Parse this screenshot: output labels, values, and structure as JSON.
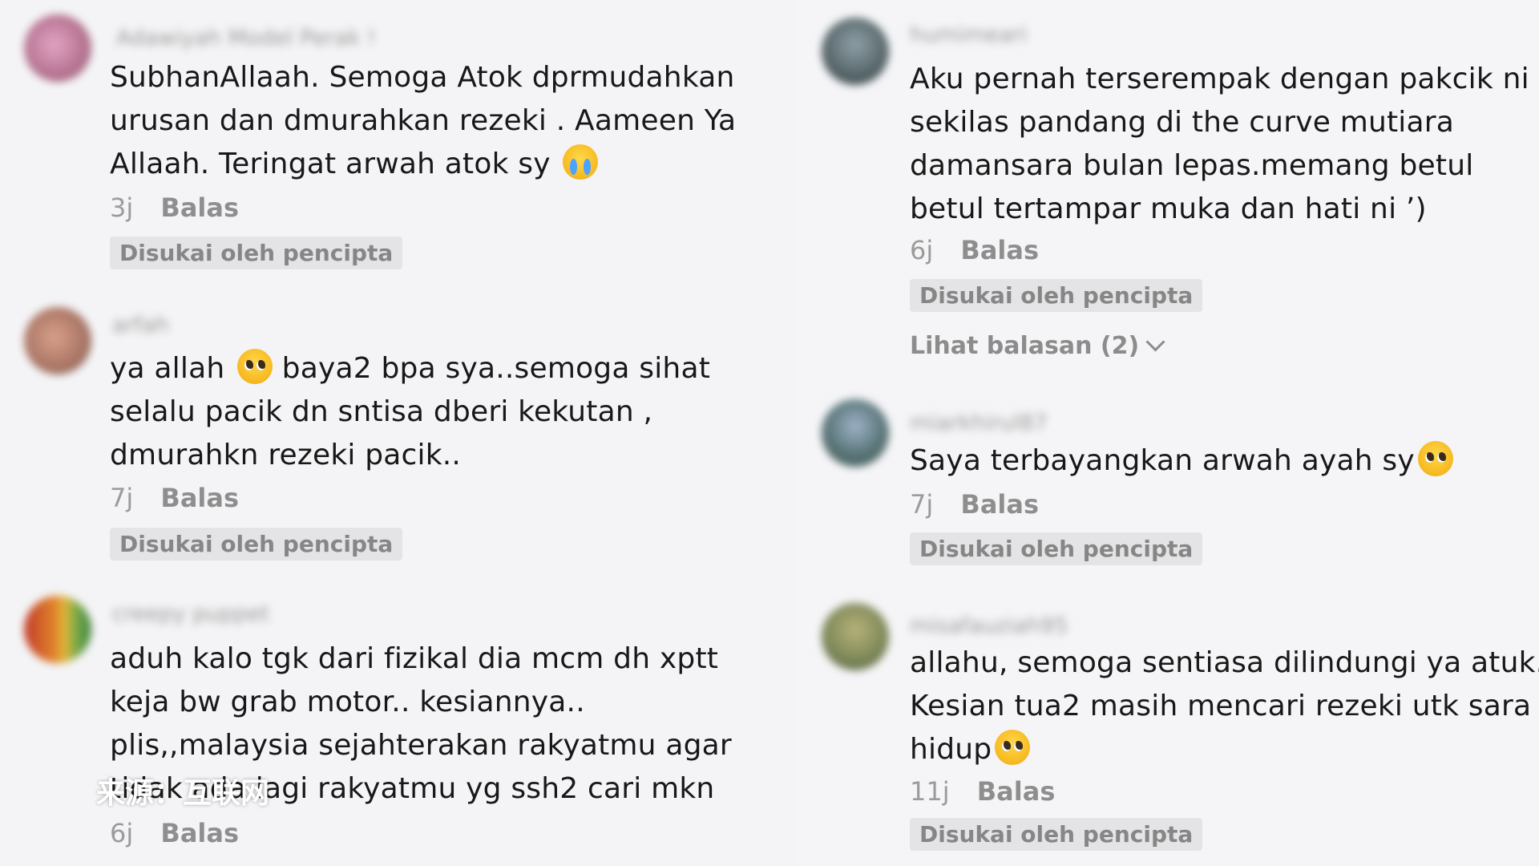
{
  "left_comments": [
    {
      "username": "Adawiyah Model Perak !",
      "lines": [
        "SubhanAllaah. Semoga Atok dprmudahkan",
        "urusan dan dmurahkan rezeki . Aameen Ya",
        "Allaah. Teringat arwah atok sy"
      ],
      "emoji": "crying-face-emoji",
      "time": "3j",
      "reply_label": "Balas",
      "liked_label": "Disukai oleh pencipta"
    },
    {
      "username": "arfah",
      "lines": [
        "ya allah",
        "baya2 bpa sya..semoga sihat",
        "selalu pacik dn sntisa dberi kekutan ,",
        "dmurahkn rezeki pacik.."
      ],
      "emoji": "pleading-face-emoji",
      "time": "7j",
      "reply_label": "Balas",
      "liked_label": "Disukai oleh pencipta"
    },
    {
      "username": "creepy puppet",
      "lines": [
        "aduh kalo tgk dari fizikal dia mcm dh xptt",
        "keja bw grab motor.. kesiannya..",
        "plis,,malaysia sejahterakan rakyatmu agar",
        "tidak ada lagi rakyatmu yg ssh2 cari mkn"
      ],
      "time": "6j",
      "reply_label": "Balas"
    }
  ],
  "right_comments": [
    {
      "username": "humimeari",
      "lines": [
        "Aku pernah terserempak dengan pakcik ni",
        "sekilas pandang di the curve mutiara",
        "damansara bulan lepas.memang betul",
        "betul tertampar muka dan hati ni ’)"
      ],
      "time": "6j",
      "reply_label": "Balas",
      "liked_label": "Disukai oleh pencipta",
      "view_replies": "Lihat balasan (2)"
    },
    {
      "username": "miarkhirul87",
      "lines": [
        "Saya terbayangkan arwah ayah sy"
      ],
      "emoji": "pleading-face-emoji",
      "time": "7j",
      "reply_label": "Balas",
      "liked_label": "Disukai oleh pencipta"
    },
    {
      "username": "misafauziah95",
      "lines": [
        "allahu, semoga sentiasa dilindungi ya atuk.",
        "Kesian tua2 masih mencari rezeki utk sara",
        "hidup"
      ],
      "emoji": "pleading-face-emoji",
      "time": "11j",
      "reply_label": "Balas",
      "liked_label": "Disukai oleh pencipta"
    }
  ],
  "watermark": "来源：互联网",
  "colors": {
    "background": "#f3f3f5",
    "text": "#181818",
    "muted": "#9b9b9b",
    "badge_bg": "#e4e4e6"
  }
}
